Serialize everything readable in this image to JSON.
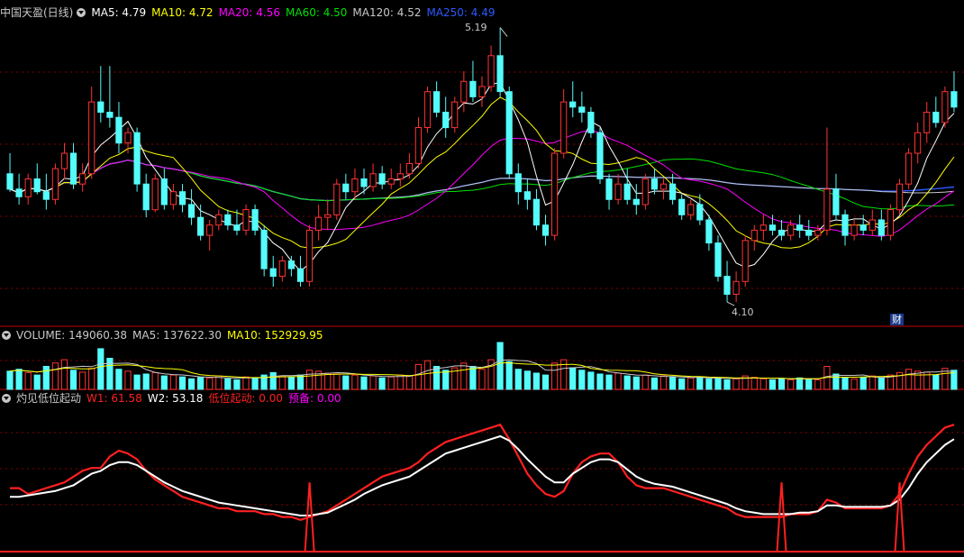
{
  "header": {
    "title": "中国天盈(日线)",
    "ma5": "MA5: 4.79",
    "ma10": "MA10: 4.72",
    "ma20": "MA20: 4.56",
    "ma60": "MA60: 4.50",
    "ma120": "MA120: 4.52",
    "ma250": "MA250: 4.49"
  },
  "volume_header": {
    "volume": "VOLUME: 149060.38",
    "ma5": "MA5: 137622.30",
    "ma10": "MA10: 152929.95"
  },
  "indicator_header": {
    "title": "灼见低位起动",
    "w1": "W1: 61.58",
    "w2": "W2: 53.18",
    "start": "低位起动: 0.00",
    "alert": "预备: 0.00"
  },
  "annotations": {
    "high": "5.19",
    "low": "4.10",
    "badge": "财"
  },
  "colors": {
    "up": "#ff3232",
    "down": "#54fcfc",
    "ma5": "#ffffff",
    "ma10": "#ffff00",
    "ma20": "#ff00ff",
    "ma60": "#00e000",
    "ma120": "#c8c8c8",
    "ma250": "#2a5aff",
    "grid": "#8a0000",
    "w1": "#ff2020",
    "w2": "#ffffff"
  },
  "chart_data": [
    {
      "type": "candlestick",
      "price_ylim": [
        4.05,
        5.22
      ],
      "candles": [
        [
          4.62,
          4.7,
          4.55,
          4.56
        ],
        [
          4.56,
          4.62,
          4.5,
          4.53
        ],
        [
          4.53,
          4.62,
          4.5,
          4.6
        ],
        [
          4.6,
          4.66,
          4.54,
          4.55
        ],
        [
          4.55,
          4.62,
          4.48,
          4.52
        ],
        [
          4.52,
          4.66,
          4.5,
          4.64
        ],
        [
          4.64,
          4.74,
          4.6,
          4.7
        ],
        [
          4.7,
          4.74,
          4.56,
          4.58
        ],
        [
          4.58,
          4.66,
          4.55,
          4.62
        ],
        [
          4.62,
          4.96,
          4.6,
          4.9
        ],
        [
          4.9,
          5.04,
          4.82,
          4.86
        ],
        [
          4.86,
          5.04,
          4.8,
          4.84
        ],
        [
          4.84,
          4.9,
          4.7,
          4.74
        ],
        [
          4.74,
          4.8,
          4.7,
          4.78
        ],
        [
          4.78,
          4.8,
          4.55,
          4.58
        ],
        [
          4.58,
          4.62,
          4.45,
          4.48
        ],
        [
          4.48,
          4.62,
          4.47,
          4.6
        ],
        [
          4.6,
          4.64,
          4.48,
          4.5
        ],
        [
          4.5,
          4.58,
          4.48,
          4.55
        ],
        [
          4.55,
          4.58,
          4.47,
          4.5
        ],
        [
          4.5,
          4.56,
          4.42,
          4.45
        ],
        [
          4.45,
          4.5,
          4.36,
          4.38
        ],
        [
          4.38,
          4.44,
          4.32,
          4.42
        ],
        [
          4.42,
          4.48,
          4.4,
          4.46
        ],
        [
          4.46,
          4.48,
          4.4,
          4.42
        ],
        [
          4.42,
          4.48,
          4.38,
          4.4
        ],
        [
          4.4,
          4.5,
          4.38,
          4.48
        ],
        [
          4.48,
          4.5,
          4.38,
          4.4
        ],
        [
          4.4,
          4.42,
          4.22,
          4.25
        ],
        [
          4.25,
          4.3,
          4.18,
          4.22
        ],
        [
          4.22,
          4.3,
          4.2,
          4.28
        ],
        [
          4.28,
          4.3,
          4.22,
          4.25
        ],
        [
          4.25,
          4.3,
          4.18,
          4.2
        ],
        [
          4.2,
          4.42,
          4.18,
          4.4
        ],
        [
          4.4,
          4.5,
          4.36,
          4.45
        ],
        [
          4.45,
          4.52,
          4.4,
          4.46
        ],
        [
          4.46,
          4.6,
          4.44,
          4.58
        ],
        [
          4.58,
          4.62,
          4.52,
          4.55
        ],
        [
          4.55,
          4.64,
          4.52,
          4.6
        ],
        [
          4.6,
          4.64,
          4.54,
          4.57
        ],
        [
          4.57,
          4.66,
          4.55,
          4.62
        ],
        [
          4.62,
          4.65,
          4.56,
          4.58
        ],
        [
          4.58,
          4.64,
          4.56,
          4.6
        ],
        [
          4.6,
          4.66,
          4.57,
          4.62
        ],
        [
          4.62,
          4.7,
          4.6,
          4.66
        ],
        [
          4.66,
          4.84,
          4.64,
          4.8
        ],
        [
          4.8,
          4.96,
          4.78,
          4.94
        ],
        [
          4.94,
          4.98,
          4.84,
          4.86
        ],
        [
          4.86,
          4.92,
          4.76,
          4.8
        ],
        [
          4.8,
          4.92,
          4.78,
          4.9
        ],
        [
          4.9,
          5.02,
          4.86,
          4.98
        ],
        [
          4.98,
          5.06,
          4.9,
          4.92
        ],
        [
          4.92,
          5.0,
          4.88,
          4.96
        ],
        [
          4.96,
          5.12,
          4.94,
          5.08
        ],
        [
          5.08,
          5.19,
          4.92,
          4.94
        ],
        [
          4.94,
          4.96,
          4.6,
          4.62
        ],
        [
          4.62,
          4.66,
          4.5,
          4.55
        ],
        [
          4.55,
          4.6,
          4.48,
          4.52
        ],
        [
          4.52,
          4.56,
          4.4,
          4.42
        ],
        [
          4.42,
          4.46,
          4.34,
          4.38
        ],
        [
          4.38,
          4.72,
          4.36,
          4.7
        ],
        [
          4.7,
          4.95,
          4.68,
          4.9
        ],
        [
          4.9,
          4.98,
          4.84,
          4.88
        ],
        [
          4.88,
          4.94,
          4.82,
          4.86
        ],
        [
          4.86,
          4.88,
          4.76,
          4.78
        ],
        [
          4.78,
          4.8,
          4.58,
          4.6
        ],
        [
          4.6,
          4.62,
          4.48,
          4.52
        ],
        [
          4.52,
          4.62,
          4.5,
          4.58
        ],
        [
          4.58,
          4.64,
          4.5,
          4.52
        ],
        [
          4.52,
          4.58,
          4.46,
          4.5
        ],
        [
          4.5,
          4.62,
          4.48,
          4.6
        ],
        [
          4.6,
          4.64,
          4.54,
          4.56
        ],
        [
          4.56,
          4.6,
          4.52,
          4.58
        ],
        [
          4.58,
          4.62,
          4.5,
          4.52
        ],
        [
          4.52,
          4.54,
          4.44,
          4.46
        ],
        [
          4.46,
          4.52,
          4.44,
          4.5
        ],
        [
          4.5,
          4.54,
          4.42,
          4.44
        ],
        [
          4.44,
          4.46,
          4.32,
          4.35
        ],
        [
          4.35,
          4.38,
          4.2,
          4.22
        ],
        [
          4.22,
          4.28,
          4.12,
          4.15
        ],
        [
          4.15,
          4.24,
          4.12,
          4.2
        ],
        [
          4.2,
          4.38,
          4.18,
          4.36
        ],
        [
          4.36,
          4.42,
          4.32,
          4.4
        ],
        [
          4.4,
          4.46,
          4.36,
          4.42
        ],
        [
          4.42,
          4.46,
          4.38,
          4.4
        ],
        [
          4.4,
          4.44,
          4.36,
          4.38
        ],
        [
          4.38,
          4.44,
          4.36,
          4.42
        ],
        [
          4.42,
          4.46,
          4.37,
          4.4
        ],
        [
          4.4,
          4.44,
          4.36,
          4.38
        ],
        [
          4.38,
          4.42,
          4.36,
          4.4
        ],
        [
          4.4,
          4.8,
          4.38,
          4.56
        ],
        [
          4.56,
          4.62,
          4.44,
          4.46
        ],
        [
          4.46,
          4.48,
          4.34,
          4.38
        ],
        [
          4.38,
          4.44,
          4.36,
          4.42
        ],
        [
          4.42,
          4.46,
          4.38,
          4.4
        ],
        [
          4.4,
          4.48,
          4.38,
          4.44
        ],
        [
          4.44,
          4.48,
          4.36,
          4.38
        ],
        [
          4.38,
          4.5,
          4.36,
          4.48
        ],
        [
          4.48,
          4.6,
          4.46,
          4.58
        ],
        [
          4.58,
          4.72,
          4.56,
          4.7
        ],
        [
          4.7,
          4.82,
          4.66,
          4.78
        ],
        [
          4.78,
          4.9,
          4.74,
          4.86
        ],
        [
          4.86,
          4.92,
          4.8,
          4.82
        ],
        [
          4.82,
          4.96,
          4.8,
          4.94
        ],
        [
          4.94,
          5.02,
          4.86,
          4.88
        ]
      ]
    },
    {
      "type": "bar",
      "title": "VOLUME",
      "values": [
        38,
        42,
        35,
        30,
        48,
        55,
        62,
        40,
        36,
        44,
        85,
        65,
        42,
        38,
        30,
        32,
        35,
        28,
        30,
        26,
        22,
        25,
        24,
        28,
        22,
        20,
        26,
        24,
        30,
        35,
        28,
        26,
        30,
        40,
        38,
        34,
        32,
        28,
        30,
        26,
        28,
        24,
        26,
        30,
        28,
        52,
        60,
        48,
        40,
        45,
        55,
        48,
        42,
        62,
        98,
        58,
        42,
        38,
        34,
        30,
        55,
        62,
        45,
        40,
        36,
        32,
        30,
        34,
        28,
        26,
        30,
        24,
        28,
        26,
        22,
        24,
        26,
        22,
        24,
        20,
        22,
        28,
        25,
        22,
        20,
        22,
        20,
        24,
        22,
        20,
        48,
        32,
        24,
        22,
        25,
        28,
        24,
        30,
        35,
        42,
        38,
        36,
        30,
        44,
        40
      ]
    },
    {
      "type": "line",
      "title": "灼见低位起动",
      "ylim": [
        0,
        100
      ],
      "series": [
        {
          "name": "W1",
          "values": [
            44,
            44,
            40,
            42,
            44,
            46,
            48,
            52,
            56,
            58,
            58,
            66,
            70,
            68,
            64,
            56,
            50,
            46,
            42,
            38,
            36,
            34,
            32,
            30,
            30,
            28,
            28,
            28,
            26,
            26,
            24,
            24,
            22,
            24,
            26,
            28,
            32,
            36,
            40,
            44,
            48,
            52,
            54,
            56,
            58,
            62,
            68,
            72,
            76,
            78,
            80,
            82,
            84,
            86,
            88,
            78,
            66,
            54,
            46,
            40,
            38,
            42,
            54,
            62,
            66,
            68,
            68,
            62,
            52,
            46,
            44,
            44,
            44,
            42,
            40,
            38,
            36,
            34,
            32,
            30,
            26,
            24,
            24,
            24,
            24,
            24,
            26,
            26,
            26,
            28,
            36,
            34,
            30,
            30,
            30,
            30,
            30,
            32,
            40,
            54,
            66,
            74,
            80,
            86,
            88
          ]
        },
        {
          "name": "W2",
          "values": [
            38,
            38,
            39,
            40,
            41,
            42,
            44,
            46,
            50,
            54,
            56,
            60,
            62,
            62,
            60,
            56,
            52,
            48,
            45,
            42,
            40,
            38,
            36,
            34,
            33,
            32,
            31,
            30,
            29,
            28,
            27,
            26,
            25,
            25,
            26,
            27,
            30,
            33,
            36,
            40,
            43,
            46,
            48,
            50,
            52,
            56,
            60,
            64,
            68,
            70,
            72,
            74,
            76,
            78,
            80,
            77,
            71,
            64,
            58,
            52,
            48,
            48,
            54,
            58,
            62,
            64,
            64,
            62,
            57,
            52,
            49,
            47,
            46,
            45,
            43,
            41,
            39,
            37,
            35,
            33,
            30,
            28,
            27,
            26,
            26,
            26,
            26,
            27,
            27,
            28,
            32,
            32,
            31,
            31,
            31,
            31,
            31,
            32,
            36,
            44,
            54,
            62,
            68,
            74,
            78
          ]
        },
        {
          "name": "低位起动",
          "values": [
            0,
            0,
            0,
            0,
            0,
            0,
            0,
            0,
            0,
            0,
            0,
            0,
            0,
            0,
            0,
            0,
            0,
            0,
            0,
            0,
            0,
            0,
            0,
            0,
            0,
            0,
            0,
            0,
            0,
            0,
            0,
            0,
            0,
            48,
            0,
            0,
            0,
            0,
            0,
            0,
            0,
            0,
            0,
            0,
            0,
            0,
            0,
            0,
            0,
            0,
            0,
            0,
            0,
            0,
            0,
            0,
            0,
            0,
            0,
            0,
            0,
            0,
            0,
            0,
            0,
            0,
            0,
            0,
            0,
            0,
            0,
            0,
            0,
            0,
            0,
            0,
            0,
            0,
            0,
            0,
            0,
            0,
            0,
            0,
            0,
            48,
            0,
            0,
            0,
            0,
            0,
            0,
            0,
            0,
            0,
            0,
            0,
            0,
            48,
            0,
            0,
            0,
            0,
            0,
            0
          ]
        }
      ]
    }
  ]
}
